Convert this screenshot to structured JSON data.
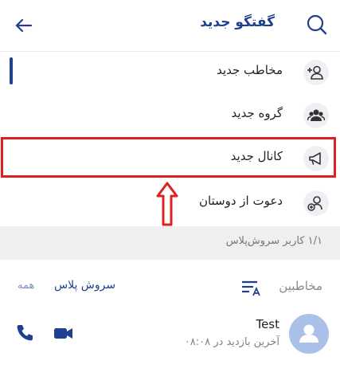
{
  "header": {
    "title": "گفتگو جدید",
    "icons": {
      "search": "search-icon",
      "back": "back-arrow-icon"
    }
  },
  "menu": [
    {
      "label": "مخاطب جدید",
      "icon": "add-contact-icon"
    },
    {
      "label": "گروه جدید",
      "icon": "group-icon"
    },
    {
      "label": "کانال جدید",
      "icon": "megaphone-icon"
    },
    {
      "label": "دعوت از دوستان",
      "icon": "invite-icon"
    }
  ],
  "members": {
    "count_text": "۱/۱ کاربر سروش‌پلاس"
  },
  "contacts_header": {
    "title": "مخاطبین",
    "filter_active": "سروش پلاس",
    "filter_all": "همه",
    "sort_icon": "sort-az-icon"
  },
  "contact": {
    "name": "Test",
    "status": "آخرین بازدید در ۰۸:۰۸",
    "call_icon": "phone-icon",
    "video_icon": "video-camera-icon"
  },
  "colors": {
    "accent": "#1f3f8f",
    "highlight": "#e02020",
    "avatar": "#a9c1e6"
  }
}
